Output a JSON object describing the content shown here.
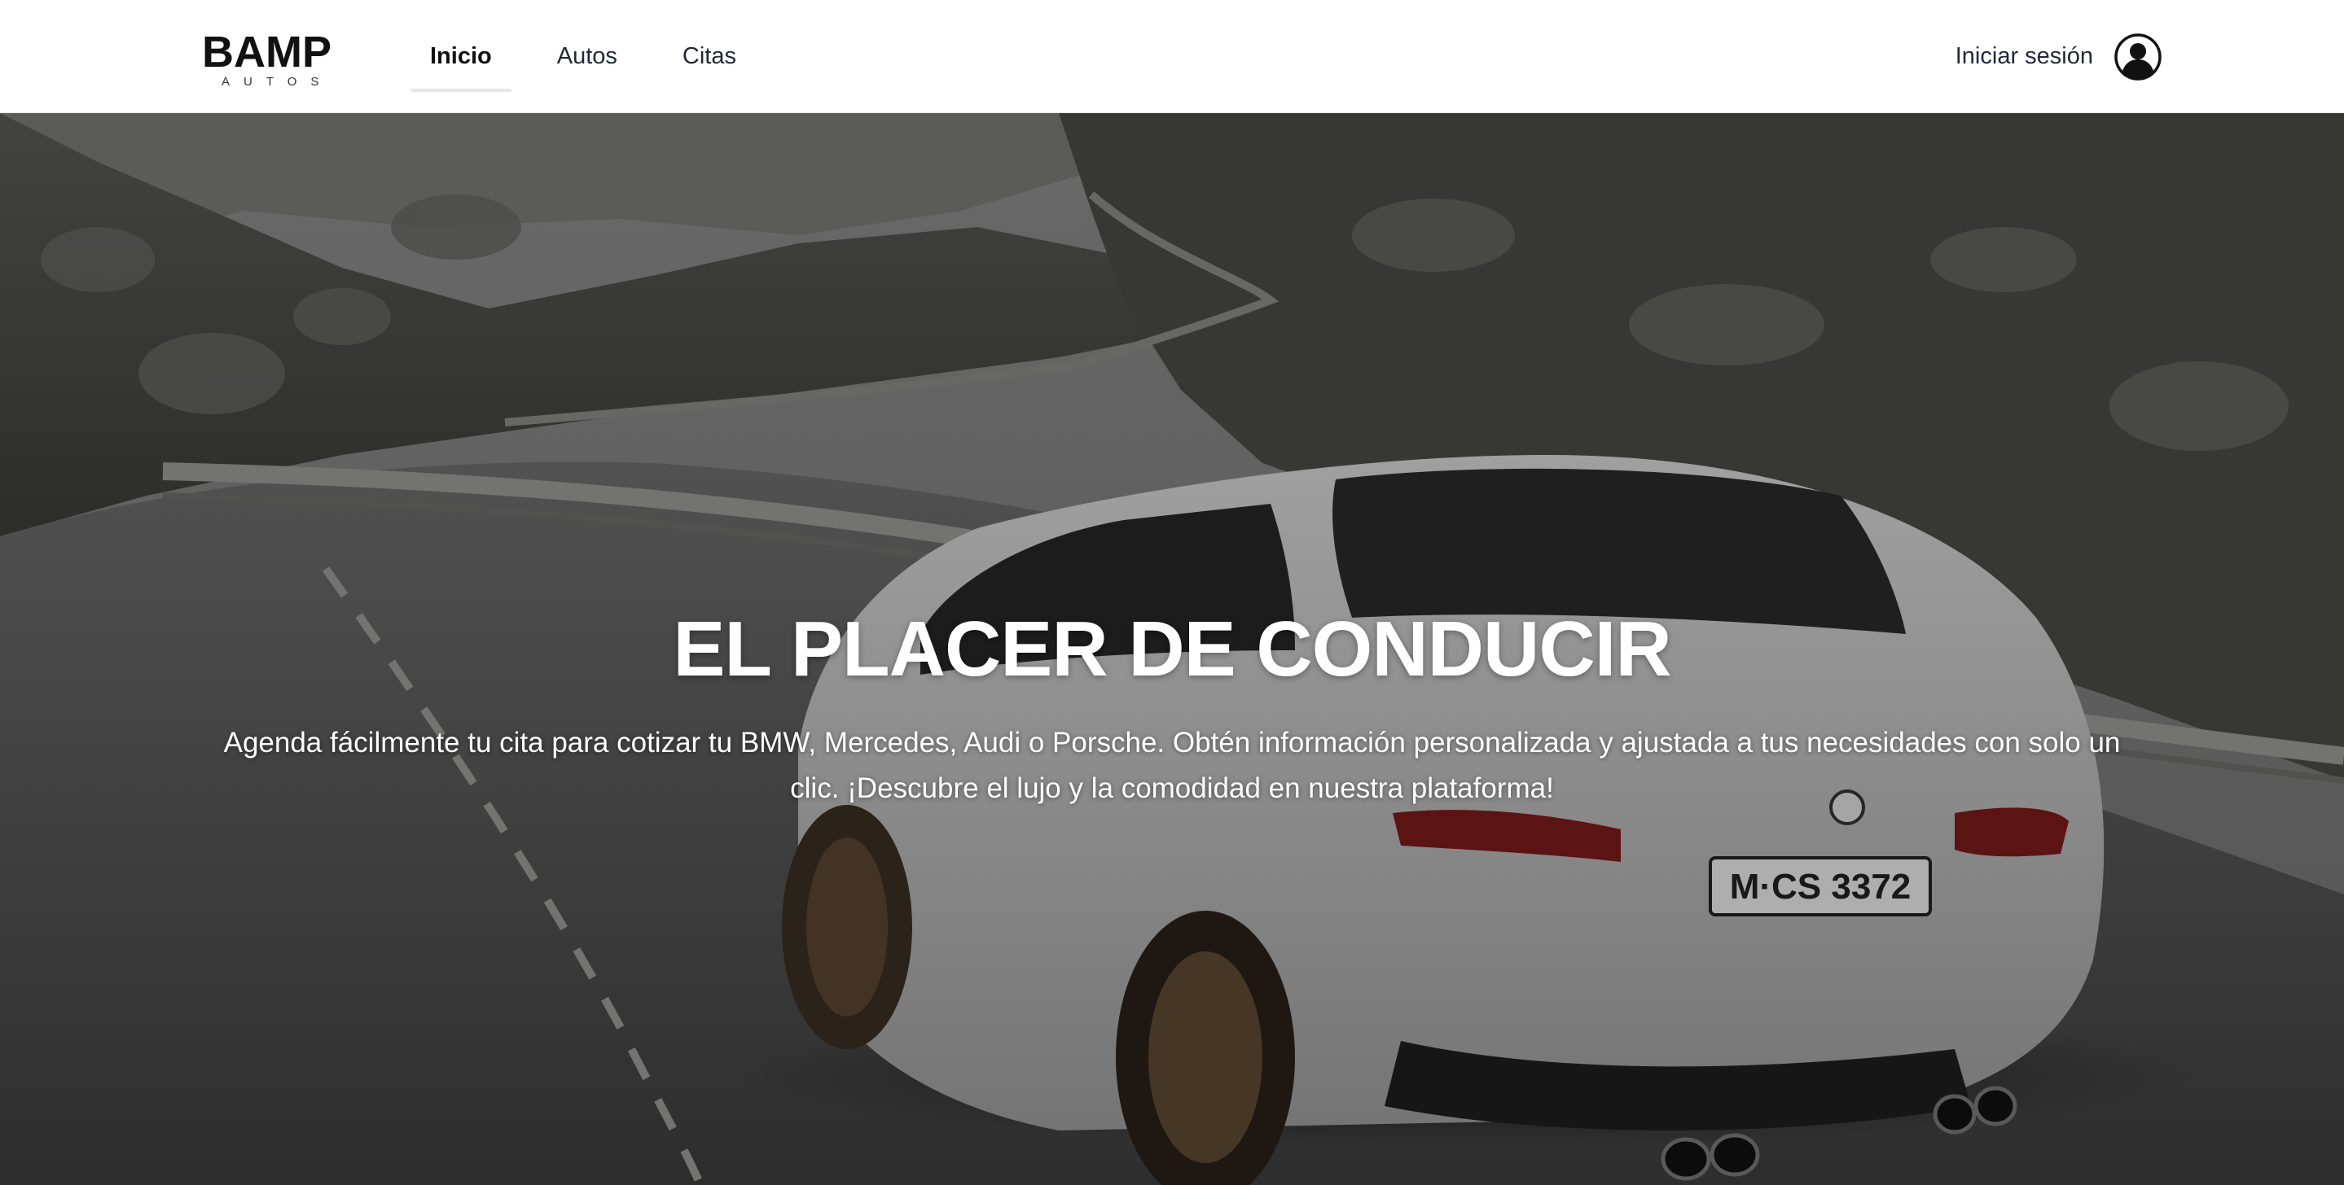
{
  "brand": {
    "name": "BAMP",
    "tagline": "AUTOS"
  },
  "nav": {
    "items": [
      {
        "label": "Inicio",
        "active": true
      },
      {
        "label": "Autos",
        "active": false
      },
      {
        "label": "Citas",
        "active": false
      }
    ]
  },
  "account": {
    "login_label": "Iniciar sesión",
    "icon": "user-circle-icon"
  },
  "hero": {
    "title": "EL PLACER DE CONDUCIR",
    "description": "Agenda fácilmente tu cita para cotizar tu BMW, Mercedes, Audi o Porsche. Obtén información personalizada y ajustada a tus necesidades con solo un clic. ¡Descubre el lujo y la comodidad en nuestra plataforma!",
    "plate_text": "M·CS 3372",
    "image": "white-bmw-m3-on-mountain-road"
  },
  "colors": {
    "header_bg": "#ffffff",
    "text_dark": "#111111",
    "hero_text": "#ffffff"
  }
}
